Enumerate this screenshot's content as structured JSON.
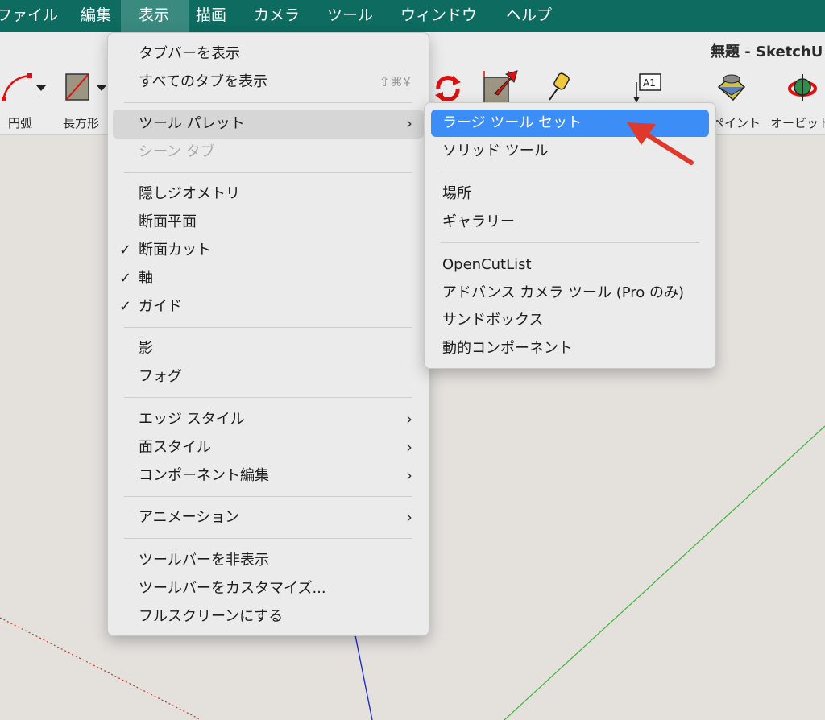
{
  "menubar": {
    "items": [
      "ファイル",
      "編集",
      "表示",
      "描画",
      "カメラ",
      "ツール",
      "ウィンドウ",
      "ヘルプ"
    ],
    "active": "表示"
  },
  "window": {
    "title": "無題 - SketchU"
  },
  "toolbar": {
    "tools": [
      {
        "label": "円弧",
        "icon": "arc-icon"
      },
      {
        "label": "長方形",
        "icon": "rectangle-icon"
      },
      {
        "label": "",
        "icon": "rotate-icon"
      },
      {
        "label": "",
        "icon": "push-pull-icon"
      },
      {
        "label": "",
        "icon": "tape-measure-icon"
      },
      {
        "label": "",
        "icon": "text-label-icon",
        "icon_text": "A1"
      },
      {
        "label": "ペイント",
        "icon": "paint-bucket-icon"
      },
      {
        "label": "オービット",
        "icon": "orbit-icon"
      }
    ]
  },
  "view_menu": {
    "items": [
      {
        "label": "タブバーを表示"
      },
      {
        "label": "すべてのタブを表示",
        "shortcut": "⇧⌘¥"
      },
      {
        "label": "ツール パレット",
        "submenu": true,
        "highlighted": true
      },
      {
        "label": "シーン タブ",
        "disabled": true
      },
      {
        "label": "隠しジオメトリ"
      },
      {
        "label": "断面平面"
      },
      {
        "label": "断面カット",
        "checked": true
      },
      {
        "label": "軸",
        "checked": true
      },
      {
        "label": "ガイド",
        "checked": true
      },
      {
        "label": "影"
      },
      {
        "label": "フォグ"
      },
      {
        "label": "エッジ スタイル",
        "submenu": true
      },
      {
        "label": "面スタイル",
        "submenu": true
      },
      {
        "label": "コンポーネント編集",
        "submenu": true
      },
      {
        "label": "アニメーション",
        "submenu": true
      },
      {
        "label": "ツールバーを非表示"
      },
      {
        "label": "ツールバーをカスタマイズ..."
      },
      {
        "label": "フルスクリーンにする"
      }
    ],
    "check_glyph": "✓",
    "chevron_glyph": "›"
  },
  "palette_submenu": {
    "items": [
      {
        "label": "ラージ ツール セット",
        "active": true
      },
      {
        "label": "ソリッド ツール"
      },
      {
        "label": "場所"
      },
      {
        "label": "ギャラリー"
      },
      {
        "label": "OpenCutList"
      },
      {
        "label": "アドバンス カメラ ツール (Pro のみ)"
      },
      {
        "label": "サンドボックス"
      },
      {
        "label": "動的コンポーネント"
      }
    ]
  },
  "colors": {
    "menubar": "#0d6b5f",
    "highlight": "#3d8df7",
    "annotation_arrow": "#e0382a",
    "axis_green": "#3bb53b",
    "axis_blue": "#1f2fd0",
    "axis_red": "#c23a2a"
  }
}
